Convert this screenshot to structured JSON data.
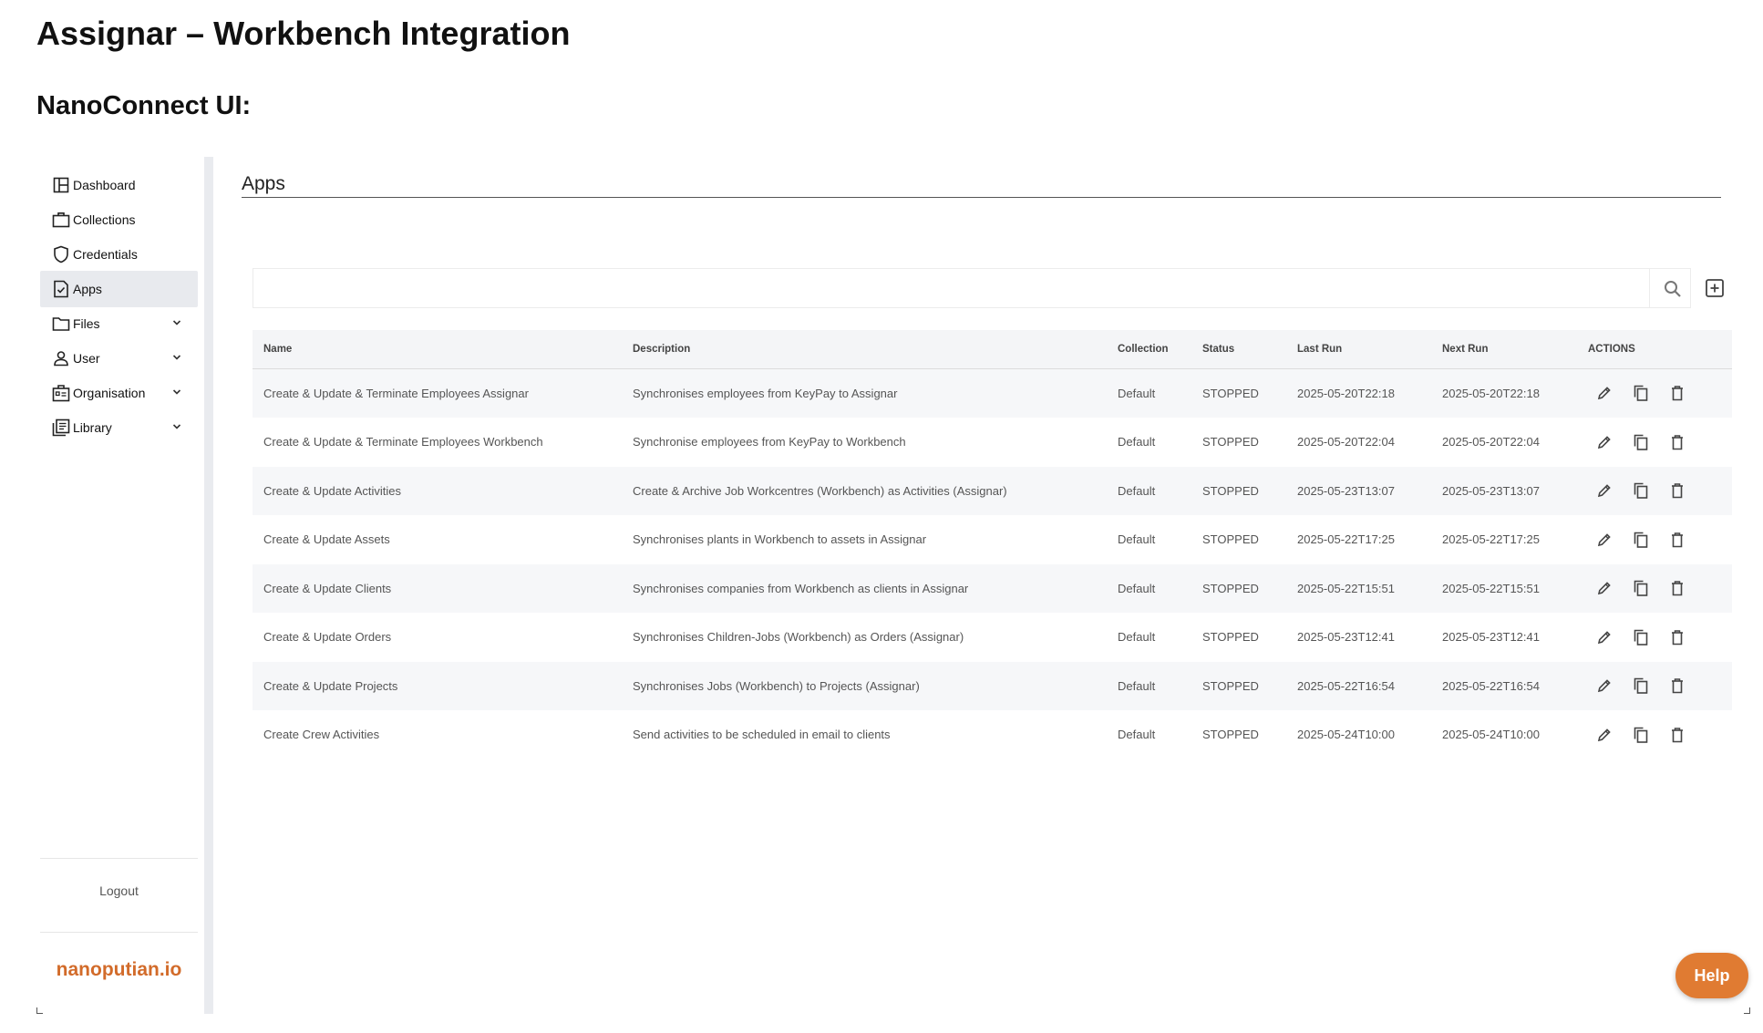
{
  "document": {
    "title": "Assignar – Workbench Integration",
    "subtitle": "NanoConnect UI:"
  },
  "sidebar": {
    "items": [
      {
        "label": "Dashboard",
        "icon": "dashboard-icon"
      },
      {
        "label": "Collections",
        "icon": "briefcase-icon"
      },
      {
        "label": "Credentials",
        "icon": "shield-icon"
      },
      {
        "label": "Apps",
        "icon": "app-document-icon",
        "active": true
      },
      {
        "label": "Files",
        "icon": "folder-icon",
        "expandable": true
      },
      {
        "label": "User",
        "icon": "user-icon",
        "expandable": true
      },
      {
        "label": "Organisation",
        "icon": "organisation-icon",
        "expandable": true
      },
      {
        "label": "Library",
        "icon": "library-icon",
        "expandable": true
      }
    ],
    "logout": "Logout",
    "brand": "nanoputian.io"
  },
  "main": {
    "title": "Apps",
    "search": {
      "value": "",
      "placeholder": ""
    },
    "table": {
      "columns": [
        "Name",
        "Description",
        "Collection",
        "Status",
        "Last Run",
        "Next Run",
        "ACTIONS"
      ],
      "rows": [
        {
          "name": "Create & Update & Terminate Employees Assignar",
          "description": "Synchronises employees from KeyPay to Assignar",
          "collection": "Default",
          "status": "STOPPED",
          "last_run": "2025-05-20T22:18",
          "next_run": "2025-05-20T22:18"
        },
        {
          "name": "Create & Update & Terminate Employees Workbench",
          "description": "Synchronise employees from KeyPay to Workbench",
          "collection": "Default",
          "status": "STOPPED",
          "last_run": "2025-05-20T22:04",
          "next_run": "2025-05-20T22:04"
        },
        {
          "name": "Create & Update Activities",
          "description": "Create & Archive Job Workcentres (Workbench) as Activities (Assignar)",
          "collection": "Default",
          "status": "STOPPED",
          "last_run": "2025-05-23T13:07",
          "next_run": "2025-05-23T13:07"
        },
        {
          "name": "Create & Update Assets",
          "description": "Synchronises plants in Workbench to assets in Assignar",
          "collection": "Default",
          "status": "STOPPED",
          "last_run": "2025-05-22T17:25",
          "next_run": "2025-05-22T17:25"
        },
        {
          "name": "Create & Update Clients",
          "description": "Synchronises companies from Workbench as clients in Assignar",
          "collection": "Default",
          "status": "STOPPED",
          "last_run": "2025-05-22T15:51",
          "next_run": "2025-05-22T15:51"
        },
        {
          "name": "Create & Update Orders",
          "description": "Synchronises Children-Jobs (Workbench) as Orders (Assignar)",
          "collection": "Default",
          "status": "STOPPED",
          "last_run": "2025-05-23T12:41",
          "next_run": "2025-05-23T12:41"
        },
        {
          "name": "Create & Update Projects",
          "description": "Synchronises Jobs (Workbench) to Projects (Assignar)",
          "collection": "Default",
          "status": "STOPPED",
          "last_run": "2025-05-22T16:54",
          "next_run": "2025-05-22T16:54"
        },
        {
          "name": "Create Crew Activities",
          "description": "Send activities to be scheduled in email to clients",
          "collection": "Default",
          "status": "STOPPED",
          "last_run": "2025-05-24T10:00",
          "next_run": "2025-05-24T10:00"
        }
      ],
      "row_actions": [
        "edit-icon",
        "copy-icon",
        "delete-icon"
      ]
    }
  },
  "help": {
    "label": "Help"
  },
  "colors": {
    "brand": "#d26b2a",
    "help_button": "#e07b32",
    "active_nav": "#e8eaee",
    "sidebar_divider": "#e9ebef"
  }
}
